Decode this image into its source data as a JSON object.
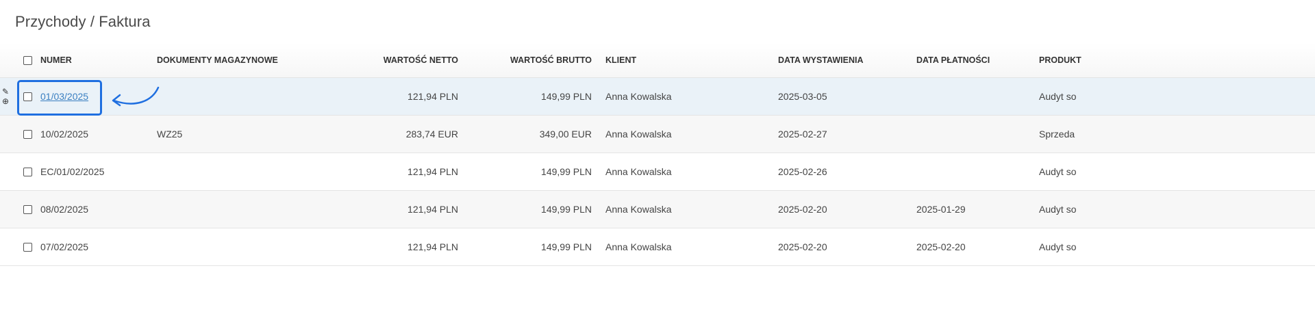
{
  "page": {
    "title": "Przychody / Faktura"
  },
  "table": {
    "headers": {
      "numer": "NUMER",
      "dokumenty": "DOKUMENTY MAGAZYNOWE",
      "netto": "WARTOŚĆ NETTO",
      "brutto": "WARTOŚĆ BRUTTO",
      "klient": "KLIENT",
      "data_wystawienia": "DATA WYSTAWIENIA",
      "data_platnosci": "DATA PŁATNOŚCI",
      "produkt": "PRODUKT"
    },
    "rows": [
      {
        "numer": "01/03/2025",
        "dokumenty": "",
        "netto": "121,94 PLN",
        "brutto": "149,99 PLN",
        "klient": "Anna Kowalska",
        "data_wystawienia": "2025-03-05",
        "data_platnosci": "",
        "produkt": "Audyt so"
      },
      {
        "numer": "10/02/2025",
        "dokumenty": "WZ25",
        "netto": "283,74 EUR",
        "brutto": "349,00 EUR",
        "klient": "Anna Kowalska",
        "data_wystawienia": "2025-02-27",
        "data_platnosci": "",
        "produkt": "Sprzeda"
      },
      {
        "numer": "EC/01/02/2025",
        "dokumenty": "",
        "netto": "121,94 PLN",
        "brutto": "149,99 PLN",
        "klient": "Anna Kowalska",
        "data_wystawienia": "2025-02-26",
        "data_platnosci": "",
        "produkt": "Audyt so"
      },
      {
        "numer": "08/02/2025",
        "dokumenty": "",
        "netto": "121,94 PLN",
        "brutto": "149,99 PLN",
        "klient": "Anna Kowalska",
        "data_wystawienia": "2025-02-20",
        "data_platnosci": "2025-01-29",
        "produkt": "Audyt so"
      },
      {
        "numer": "07/02/2025",
        "dokumenty": "",
        "netto": "121,94 PLN",
        "brutto": "149,99 PLN",
        "klient": "Anna Kowalska",
        "data_wystawienia": "2025-02-20",
        "data_platnosci": "2025-02-20",
        "produkt": "Audyt so"
      }
    ]
  },
  "icons": {
    "edit": "pencil-icon",
    "preview": "zoom-in-icon",
    "annotation_arrow": "curved-arrow-icon"
  },
  "colors": {
    "link": "#3a7fc1",
    "highlight_row": "#eaf2f8",
    "focus_box": "#1f6fe0"
  }
}
